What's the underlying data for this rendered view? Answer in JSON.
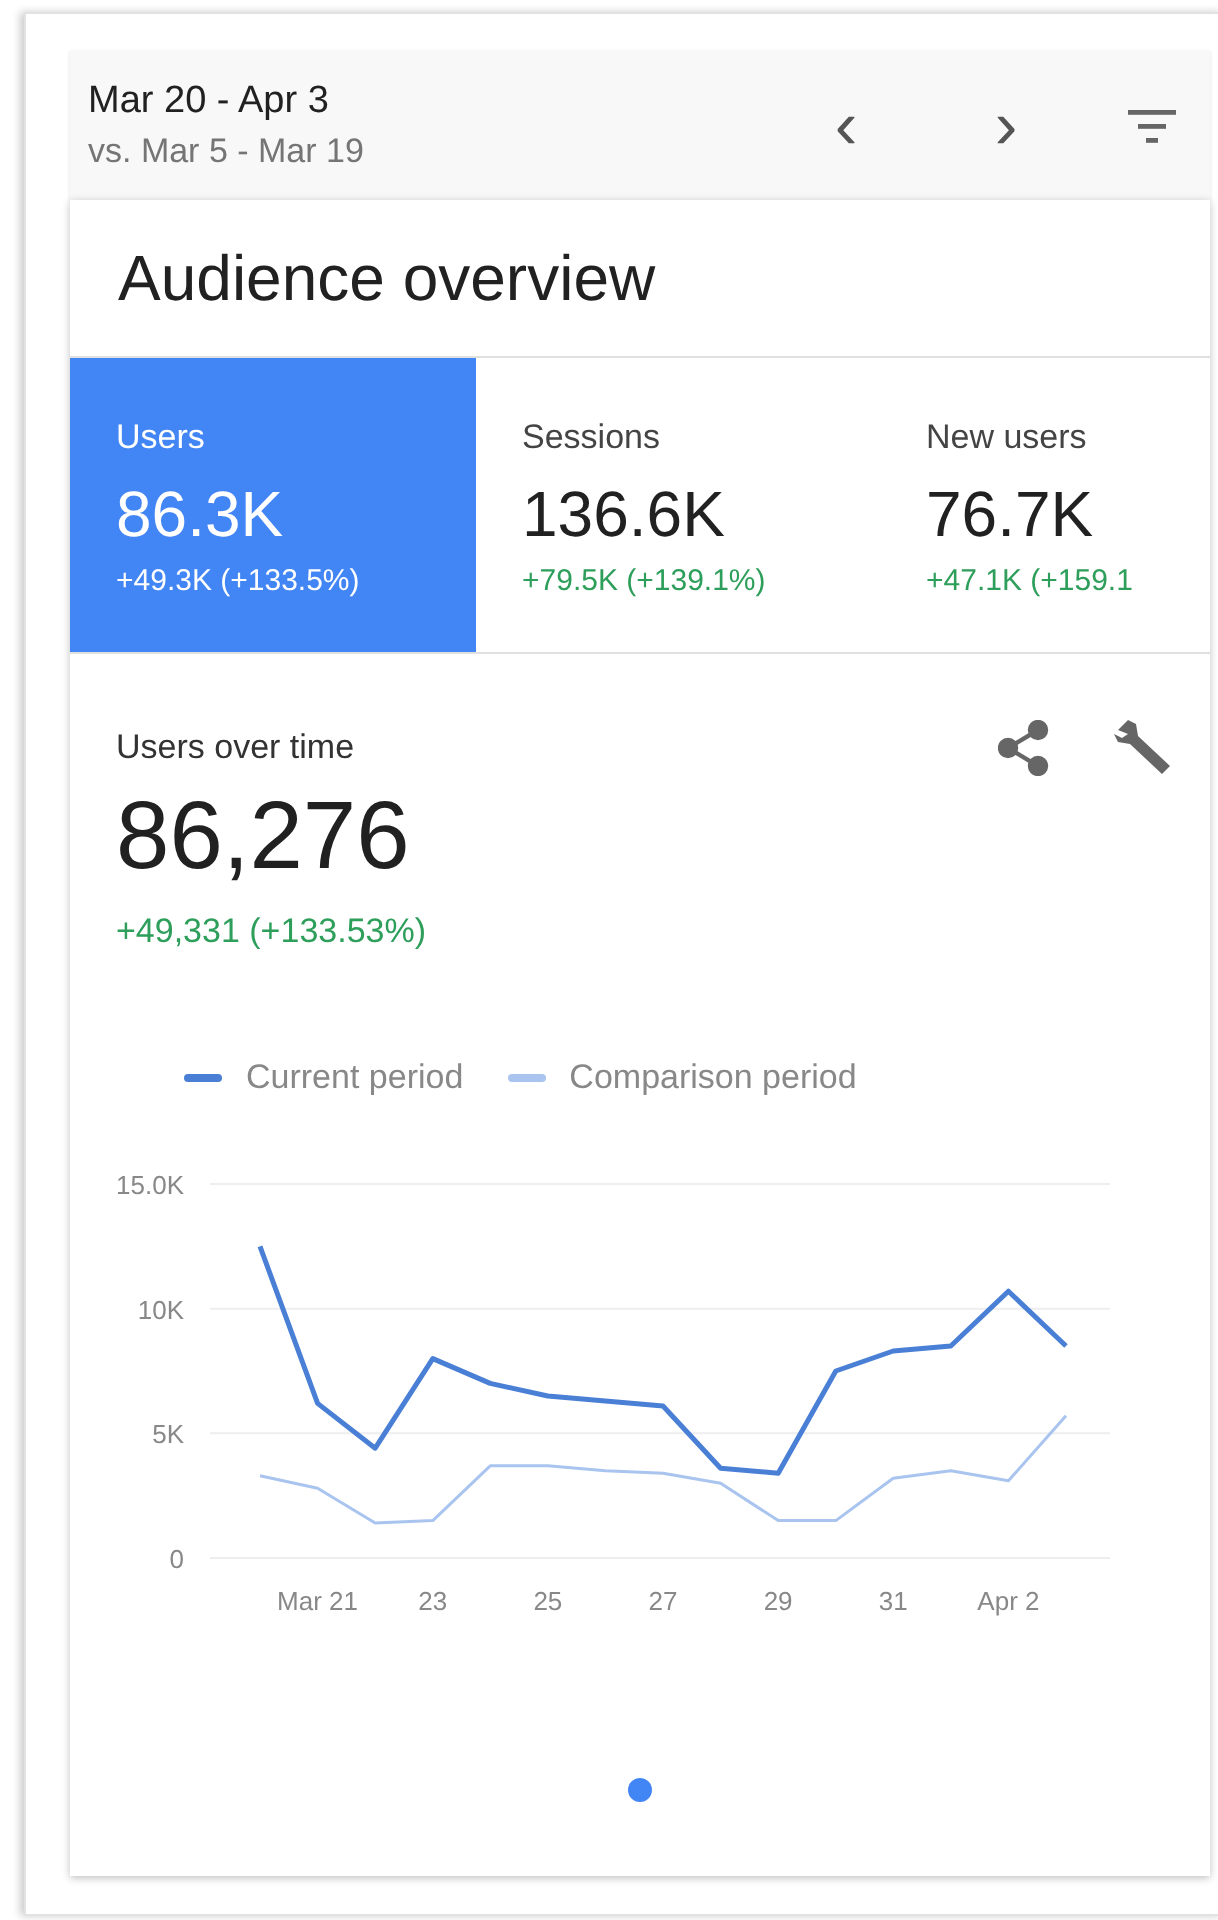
{
  "header": {
    "date_range": "Mar 20 - Apr 3",
    "comparison_range": "vs. Mar 5 - Mar 19",
    "previous": "‹",
    "next": "›"
  },
  "title": "Audience overview",
  "metrics": [
    {
      "label": "Users",
      "value": "86.3K",
      "change": "+49.3K (+133.5%)",
      "selected": true
    },
    {
      "label": "Sessions",
      "value": "136.6K",
      "change": "+79.5K (+139.1%)",
      "selected": false
    },
    {
      "label": "New users",
      "value": "76.7K",
      "change": "+47.1K (+159.1",
      "selected": false
    }
  ],
  "detail": {
    "label": "Users over time",
    "value": "86,276",
    "change": "+49,331 (+133.53%)",
    "chart_data": {
      "type": "line",
      "categories": [
        null,
        "Mar 21",
        null,
        "23",
        null,
        "25",
        null,
        "27",
        null,
        "29",
        null,
        "31",
        null,
        "Apr 2",
        null
      ],
      "series": [
        {
          "name": "Current period",
          "color": "#4a7fd6",
          "values": [
            12500,
            6200,
            4400,
            8000,
            7000,
            6500,
            6300,
            6100,
            3600,
            3400,
            7500,
            8300,
            8500,
            10700,
            8500
          ]
        },
        {
          "name": "Comparison period",
          "color": "#a9c4ef",
          "values": [
            3300,
            2800,
            1400,
            1500,
            3700,
            3700,
            3500,
            3400,
            3000,
            1500,
            1500,
            3200,
            3500,
            3100,
            5700
          ]
        }
      ],
      "ylim": [
        0,
        15000
      ],
      "yticks": [
        {
          "value": 0,
          "label": "0"
        },
        {
          "value": 5000,
          "label": "5K"
        },
        {
          "value": 10000,
          "label": "10K"
        },
        {
          "value": 15000,
          "label": "15.0K"
        }
      ]
    }
  },
  "pages": [
    {
      "selected": true
    }
  ]
}
